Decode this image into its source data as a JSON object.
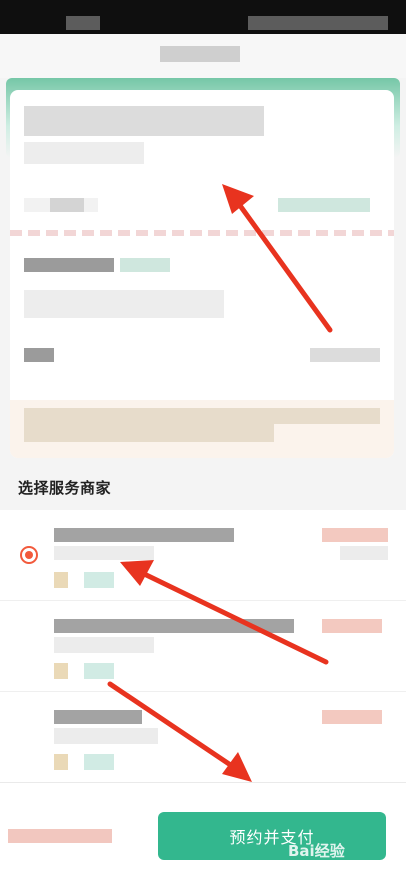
{
  "section": {
    "merchant_title": "选择服务商家"
  },
  "merchants": [
    {
      "selected": true
    },
    {
      "selected": false
    },
    {
      "selected": false
    }
  ],
  "bottom_bar": {
    "pay_button_label": "预约并支付"
  },
  "watermark": {
    "text": "Bai经验"
  },
  "colors": {
    "accent_green": "#33b78e",
    "radio_selected": "#f25a3c",
    "arrow_red": "#e8331f"
  }
}
